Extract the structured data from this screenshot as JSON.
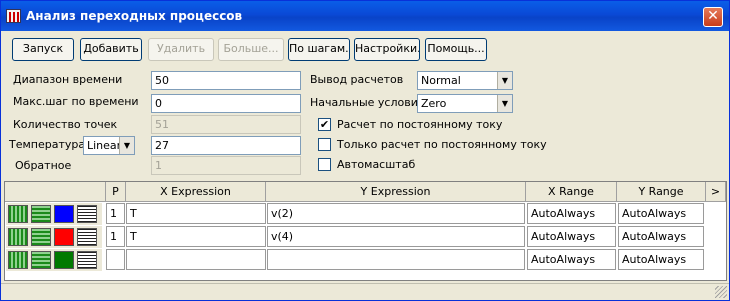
{
  "window": {
    "title": "Анализ переходных процессов",
    "close_glyph": "✕"
  },
  "toolbar": {
    "run": "Запуск",
    "add": "Добавить",
    "delete": "Удалить",
    "more": "Больше...",
    "steps": "По шагам...",
    "settings": "Настройки...",
    "help": "Помощь..."
  },
  "params": {
    "time_range": {
      "label": "Диапазон времени",
      "value": "50"
    },
    "max_step": {
      "label": "Макс.шаг по времени",
      "value": "0"
    },
    "points": {
      "label": "Количество точек",
      "value": "51"
    },
    "temperature": {
      "label": "Температура",
      "mode": "Linear",
      "value": "27"
    },
    "inverse": {
      "label": "Обратное",
      "value": "1"
    }
  },
  "options": {
    "output": {
      "label": "Вывод расчетов",
      "value": "Normal"
    },
    "initial": {
      "label": "Начальные условия",
      "value": "Zero"
    },
    "dc_calc": {
      "label": "Расчет по постоянному току",
      "checked": true
    },
    "dc_only": {
      "label": "Только расчет по постоянному току",
      "checked": false
    },
    "autoscale": {
      "label": "Автомасштаб",
      "checked": false
    }
  },
  "grid": {
    "headers": {
      "p": "P",
      "x": "X Expression",
      "y": "Y Expression",
      "xr": "X Range",
      "yr": "Y Range",
      "more": ">"
    },
    "rows": [
      {
        "p": "1",
        "x": "T",
        "y": "v(2)",
        "xr": "AutoAlways",
        "yr": "AutoAlways",
        "color": "#0000ff"
      },
      {
        "p": "1",
        "x": "T",
        "y": "v(4)",
        "xr": "AutoAlways",
        "yr": "AutoAlways",
        "color": "#ff0000"
      },
      {
        "p": "",
        "x": "",
        "y": "",
        "xr": "AutoAlways",
        "yr": "AutoAlways",
        "color": "#007a00"
      }
    ]
  },
  "icons": {
    "check": "✔",
    "dropdown": "▼"
  }
}
